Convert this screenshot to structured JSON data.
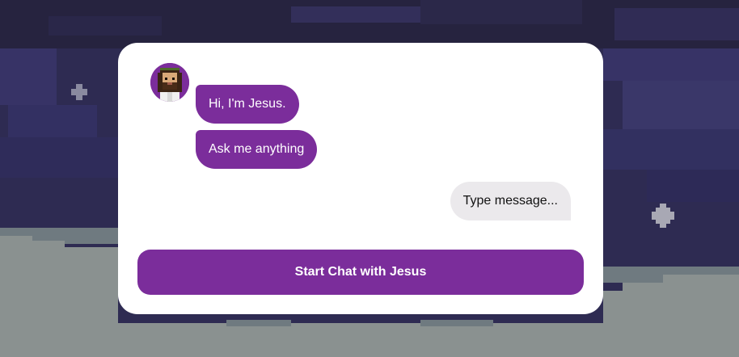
{
  "background": {
    "scene": "pixel-art night sky with clouds",
    "sky_color": "#2e2b52",
    "cloud_color": "#8a9190"
  },
  "chat": {
    "avatar_icon": "jesus-avatar-icon",
    "bot_messages": [
      "Hi, I'm Jesus.",
      "Ask me anything"
    ],
    "user_message_placeholder": "Type message..."
  },
  "cta": {
    "label": "Start Chat with Jesus"
  },
  "colors": {
    "accent": "#7b2d9b",
    "card": "#ffffff",
    "user_bubble": "#ebe9ec"
  }
}
